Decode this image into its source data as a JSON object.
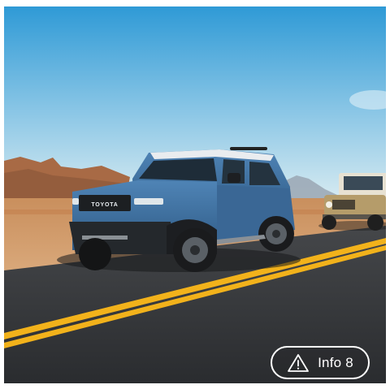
{
  "photo": {
    "subject": "vehicle-photo",
    "grille_lettering": "TOYOTA"
  },
  "badge": {
    "label": "Info 8",
    "icon": "warning-triangle-icon"
  },
  "colors": {
    "sky_top": "#2f9ad6",
    "sky_bottom": "#cfe6f0",
    "road": "#2f3134",
    "lane_lines": "#f2b21b",
    "vehicle_blue": "#3f6f9e",
    "badge_border": "#ffffff"
  }
}
